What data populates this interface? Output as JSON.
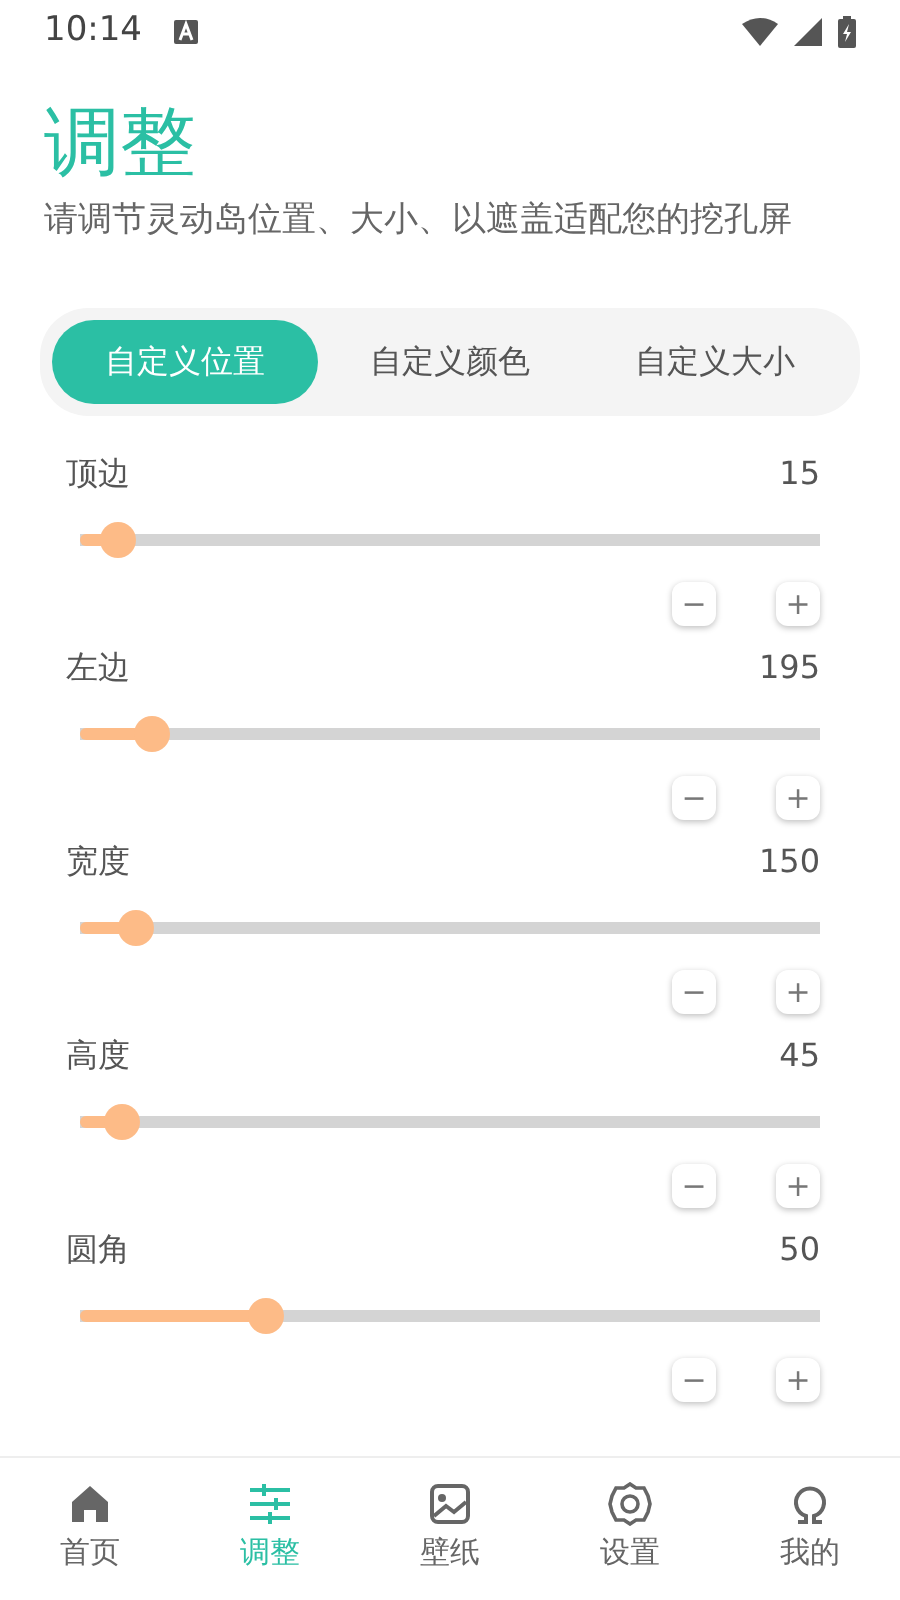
{
  "status_bar": {
    "time": "10:14"
  },
  "header": {
    "title": "调整",
    "subtitle": "请调节灵动岛位置、大小、以遮盖适配您的挖孔屏"
  },
  "tabs": [
    {
      "label": "自定义位置",
      "selected": true
    },
    {
      "label": "自定义颜色",
      "selected": false
    },
    {
      "label": "自定义大小",
      "selected": false
    }
  ],
  "sliders": [
    {
      "label": "顶边",
      "reading": "15",
      "level": 0.05,
      "minus": "−",
      "plus": "+"
    },
    {
      "label": "左边",
      "reading": "195",
      "level": 0.098,
      "minus": "−",
      "plus": "+"
    },
    {
      "label": "宽度",
      "reading": "150",
      "level": 0.075,
      "minus": "−",
      "plus": "+"
    },
    {
      "label": "高度",
      "reading": "45",
      "level": 0.057,
      "minus": "−",
      "plus": "+"
    },
    {
      "label": "圆角",
      "reading": "50",
      "level": 0.25,
      "minus": "−",
      "plus": "+"
    }
  ],
  "bottom_nav": [
    {
      "label": "首页",
      "selected": false
    },
    {
      "label": "调整",
      "selected": true
    },
    {
      "label": "壁纸",
      "selected": false
    },
    {
      "label": "设置",
      "selected": false
    },
    {
      "label": "我的",
      "selected": false
    }
  ]
}
